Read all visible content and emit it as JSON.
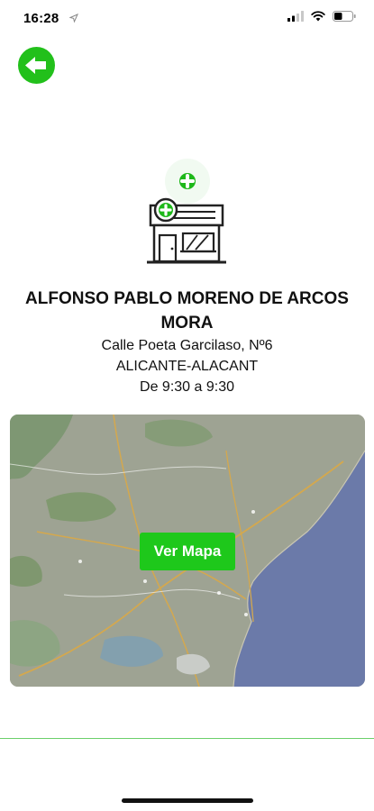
{
  "status_bar": {
    "time": "16:28",
    "icons": [
      "location-arrow-icon",
      "signal-icon",
      "wifi-icon",
      "battery-icon"
    ]
  },
  "back_button": {
    "icon": "arrow-left-icon"
  },
  "pharmacy": {
    "icon": "pharmacy-store-icon",
    "name_line1": "ALFONSO PABLO MORENO DE ARCOS",
    "name_line2": "MORA",
    "address": "Calle Poeta Garcilaso, Nº6",
    "city": "ALICANTE-ALACANT",
    "hours": "De 9:30 a 9:30"
  },
  "map": {
    "button_label": "Ver Mapa"
  },
  "colors": {
    "accent": "#22c01b",
    "map_land": "#9aa08f",
    "map_sea": "#6878a8"
  }
}
